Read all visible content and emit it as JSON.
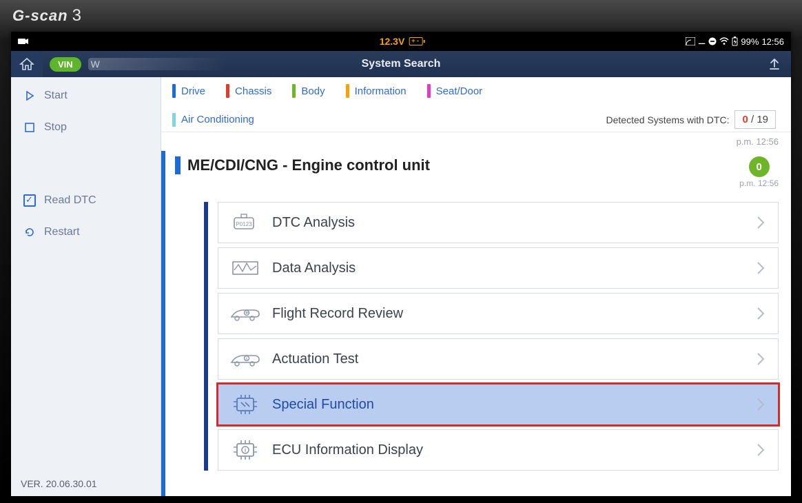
{
  "brand": "G-scan",
  "brand_suffix": "3",
  "status": {
    "voltage": "12.3V",
    "battery_pct": "99%",
    "clock": "12:56"
  },
  "header": {
    "vin_badge": "VIN",
    "vin_value": "W",
    "title": "System Search"
  },
  "sidebar": {
    "start": "Start",
    "stop": "Stop",
    "read_dtc": "Read DTC",
    "restart": "Restart",
    "version": "VER. 20.06.30.01"
  },
  "categories": {
    "drive": "Drive",
    "chassis": "Chassis",
    "body": "Body",
    "information": "Information",
    "seat_door": "Seat/Door",
    "air_conditioning": "Air Conditioning",
    "colors": {
      "drive": "#1e6bd6",
      "chassis": "#e23a2e",
      "body": "#6eb52a",
      "information": "#f5a300",
      "seat_door": "#e23ac0",
      "air_conditioning": "#7dd7e0"
    }
  },
  "dtc": {
    "label": "Detected Systems with DTC:",
    "count_current": "0",
    "count_sep": " / ",
    "count_total": "19"
  },
  "timestamps": {
    "top": "p.m. 12:56",
    "ecu": "p.m. 12:56"
  },
  "ecu": {
    "title": "ME/CDI/CNG - Engine control unit",
    "dtc_count": "0",
    "functions": [
      {
        "id": "dtc-analysis",
        "label": "DTC Analysis",
        "selected": false
      },
      {
        "id": "data-analysis",
        "label": "Data Analysis",
        "selected": false
      },
      {
        "id": "flight-record-review",
        "label": "Flight Record Review",
        "selected": false
      },
      {
        "id": "actuation-test",
        "label": "Actuation Test",
        "selected": false
      },
      {
        "id": "special-function",
        "label": "Special Function",
        "selected": true,
        "highlight": true
      },
      {
        "id": "ecu-information-display",
        "label": "ECU Information Display",
        "selected": false
      }
    ]
  }
}
